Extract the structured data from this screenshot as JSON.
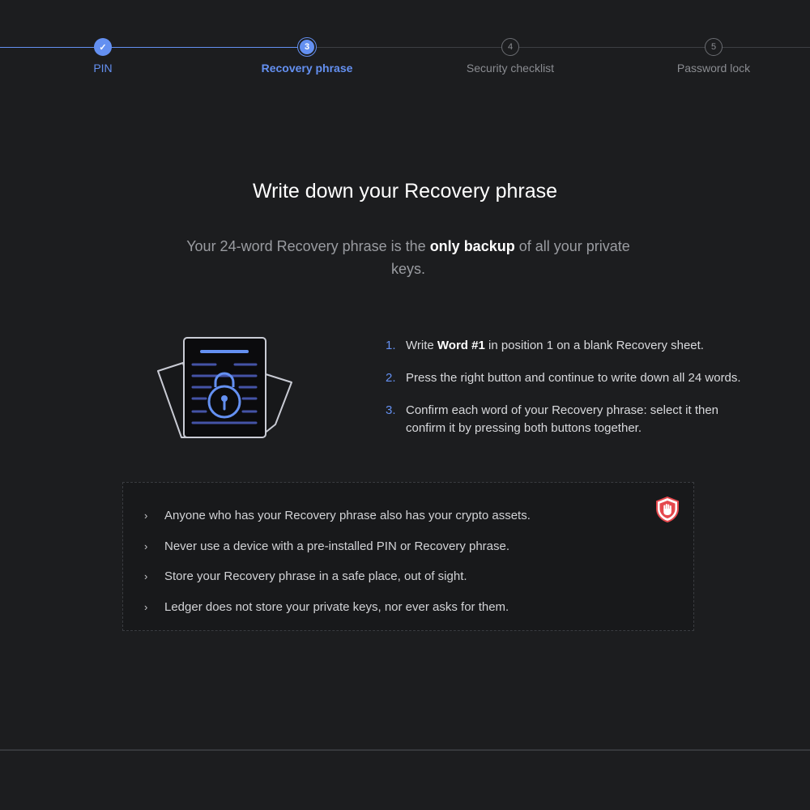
{
  "stepper": {
    "steps": [
      {
        "label": "PIN",
        "marker": "✓",
        "state": "done"
      },
      {
        "label": "Recovery phrase",
        "marker": "3",
        "state": "active"
      },
      {
        "label": "Security checklist",
        "marker": "4",
        "state": "todo"
      },
      {
        "label": "Password lock",
        "marker": "5",
        "state": "todo"
      }
    ]
  },
  "main": {
    "title": "Write down your Recovery phrase",
    "subtitle": {
      "before": "Your 24-word Recovery phrase is the ",
      "bold": "only backup",
      "after": " of all your private keys."
    },
    "illustration_icon": "locked-document-icon",
    "instructions": [
      {
        "num": "1.",
        "before": "Write ",
        "bold": "Word #1",
        "after": " in position 1 on a blank Recovery sheet."
      },
      {
        "num": "2.",
        "before": "Press the right button and continue to write down all 24 words.",
        "bold": "",
        "after": ""
      },
      {
        "num": "3.",
        "before": "Confirm each word of your Recovery phrase: select it then confirm it by pressing both buttons together.",
        "bold": "",
        "after": ""
      }
    ]
  },
  "warnings": {
    "icon": "stop-hand-shield-icon",
    "items": [
      "Anyone who has your Recovery phrase also has your crypto assets.",
      "Never use a device with a pre-installed PIN or Recovery phrase.",
      "Store your Recovery phrase in a safe place, out of sight.",
      "Ledger does not store your private keys, nor ever asks for them."
    ],
    "chevron": "›"
  },
  "colors": {
    "accent": "#6490f1",
    "background": "#1c1d1f",
    "warning_red": "#e5484d"
  }
}
